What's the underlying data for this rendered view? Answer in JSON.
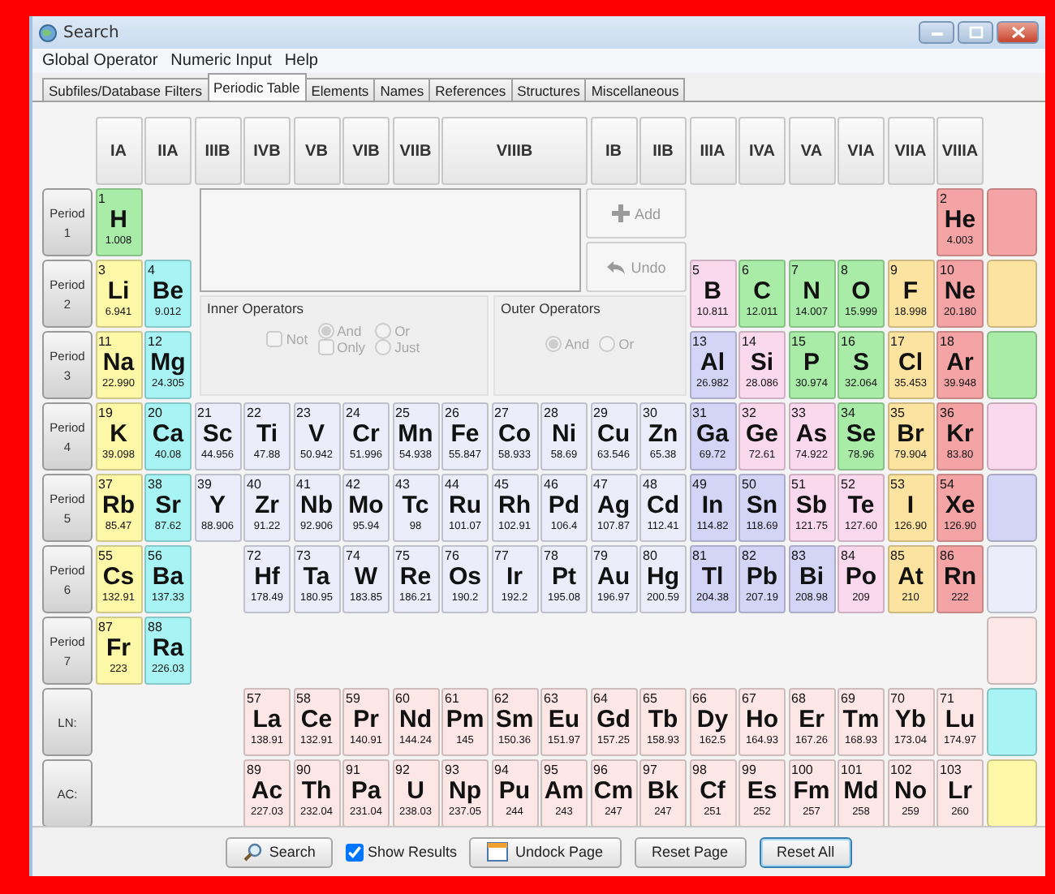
{
  "window": {
    "title": "Search"
  },
  "menu": [
    "Global Operator",
    "Numeric Input",
    "Help"
  ],
  "tabs": [
    {
      "label": "Subfiles/Database Filters",
      "selected": false
    },
    {
      "label": "Periodic Table",
      "selected": true
    },
    {
      "label": "Elements",
      "selected": false
    },
    {
      "label": "Names",
      "selected": false
    },
    {
      "label": "References",
      "selected": false
    },
    {
      "label": "Structures",
      "selected": false
    },
    {
      "label": "Miscellaneous",
      "selected": false
    }
  ],
  "groups": [
    "IA",
    "IIA",
    "IIIB",
    "IVB",
    "VB",
    "VIB",
    "VIIB",
    "VIIIB",
    "IB",
    "IIB",
    "IIIA",
    "IVA",
    "VA",
    "VIA",
    "VIIA",
    "VIIIA"
  ],
  "rows": [
    {
      "label": "Period",
      "number": "1",
      "left": [
        {
          "number": "1",
          "symbol": "H",
          "mass": "1.008",
          "color": "#a8eca8"
        }
      ],
      "right": [
        {
          "number": "2",
          "symbol": "He",
          "mass": "4.003",
          "color": "#f4a4a4"
        }
      ]
    },
    {
      "label": "Period",
      "number": "2",
      "left": [
        {
          "number": "3",
          "symbol": "Li",
          "mass": "6.941",
          "color": "#fdf7a8"
        },
        {
          "number": "4",
          "symbol": "Be",
          "mass": "9.012",
          "color": "#a8f4f4"
        }
      ],
      "right": [
        {
          "number": "5",
          "symbol": "B",
          "mass": "10.811",
          "color": "#fad8ee"
        },
        {
          "number": "6",
          "symbol": "C",
          "mass": "12.011",
          "color": "#a8eca8"
        },
        {
          "number": "7",
          "symbol": "N",
          "mass": "14.007",
          "color": "#a8eca8"
        },
        {
          "number": "8",
          "symbol": "O",
          "mass": "15.999",
          "color": "#a8eca8"
        },
        {
          "number": "9",
          "symbol": "F",
          "mass": "18.998",
          "color": "#fce4a0"
        },
        {
          "number": "10",
          "symbol": "Ne",
          "mass": "20.180",
          "color": "#f4a4a4"
        }
      ]
    },
    {
      "label": "Period",
      "number": "3",
      "left": [
        {
          "number": "11",
          "symbol": "Na",
          "mass": "22.990",
          "color": "#fdf7a8"
        },
        {
          "number": "12",
          "symbol": "Mg",
          "mass": "24.305",
          "color": "#a8f4f4"
        }
      ],
      "right": [
        {
          "number": "13",
          "symbol": "Al",
          "mass": "26.982",
          "color": "#d4d4f6"
        },
        {
          "number": "14",
          "symbol": "Si",
          "mass": "28.086",
          "color": "#fad8ee"
        },
        {
          "number": "15",
          "symbol": "P",
          "mass": "30.974",
          "color": "#a8eca8"
        },
        {
          "number": "16",
          "symbol": "S",
          "mass": "32.064",
          "color": "#a8eca8"
        },
        {
          "number": "17",
          "symbol": "Cl",
          "mass": "35.453",
          "color": "#fce4a0"
        },
        {
          "number": "18",
          "symbol": "Ar",
          "mass": "39.948",
          "color": "#f4a4a4"
        }
      ]
    },
    {
      "label": "Period",
      "number": "4",
      "left": [
        {
          "number": "19",
          "symbol": "K",
          "mass": "39.098",
          "color": "#fdf7a8"
        },
        {
          "number": "20",
          "symbol": "Ca",
          "mass": "40.08",
          "color": "#a8f4f4"
        },
        {
          "number": "21",
          "symbol": "Sc",
          "mass": "44.956",
          "color": "#ececfa"
        },
        {
          "number": "22",
          "symbol": "Ti",
          "mass": "47.88",
          "color": "#ececfa"
        },
        {
          "number": "23",
          "symbol": "V",
          "mass": "50.942",
          "color": "#ececfa"
        },
        {
          "number": "24",
          "symbol": "Cr",
          "mass": "51.996",
          "color": "#ececfa"
        },
        {
          "number": "25",
          "symbol": "Mn",
          "mass": "54.938",
          "color": "#ececfa"
        },
        {
          "number": "26",
          "symbol": "Fe",
          "mass": "55.847",
          "color": "#ececfa"
        },
        {
          "number": "27",
          "symbol": "Co",
          "mass": "58.933",
          "color": "#ececfa"
        },
        {
          "number": "28",
          "symbol": "Ni",
          "mass": "58.69",
          "color": "#ececfa"
        },
        {
          "number": "29",
          "symbol": "Cu",
          "mass": "63.546",
          "color": "#ececfa"
        },
        {
          "number": "30",
          "symbol": "Zn",
          "mass": "65.38",
          "color": "#ececfa"
        },
        {
          "number": "31",
          "symbol": "Ga",
          "mass": "69.72",
          "color": "#d4d4f6"
        },
        {
          "number": "32",
          "symbol": "Ge",
          "mass": "72.61",
          "color": "#fad8ee"
        },
        {
          "number": "33",
          "symbol": "As",
          "mass": "74.922",
          "color": "#fad8ee"
        },
        {
          "number": "34",
          "symbol": "Se",
          "mass": "78.96",
          "color": "#a8eca8"
        },
        {
          "number": "35",
          "symbol": "Br",
          "mass": "79.904",
          "color": "#fce4a0"
        },
        {
          "number": "36",
          "symbol": "Kr",
          "mass": "83.80",
          "color": "#f4a4a4"
        }
      ],
      "right": []
    },
    {
      "label": "Period",
      "number": "5",
      "left": [
        {
          "number": "37",
          "symbol": "Rb",
          "mass": "85.47",
          "color": "#fdf7a8"
        },
        {
          "number": "38",
          "symbol": "Sr",
          "mass": "87.62",
          "color": "#a8f4f4"
        },
        {
          "number": "39",
          "symbol": "Y",
          "mass": "88.906",
          "color": "#ececfa"
        },
        {
          "number": "40",
          "symbol": "Zr",
          "mass": "91.22",
          "color": "#ececfa"
        },
        {
          "number": "41",
          "symbol": "Nb",
          "mass": "92.906",
          "color": "#ececfa"
        },
        {
          "number": "42",
          "symbol": "Mo",
          "mass": "95.94",
          "color": "#ececfa"
        },
        {
          "number": "43",
          "symbol": "Tc",
          "mass": "98",
          "color": "#ececfa"
        },
        {
          "number": "44",
          "symbol": "Ru",
          "mass": "101.07",
          "color": "#ececfa"
        },
        {
          "number": "45",
          "symbol": "Rh",
          "mass": "102.91",
          "color": "#ececfa"
        },
        {
          "number": "46",
          "symbol": "Pd",
          "mass": "106.4",
          "color": "#ececfa"
        },
        {
          "number": "47",
          "symbol": "Ag",
          "mass": "107.87",
          "color": "#ececfa"
        },
        {
          "number": "48",
          "symbol": "Cd",
          "mass": "112.41",
          "color": "#ececfa"
        },
        {
          "number": "49",
          "symbol": "In",
          "mass": "114.82",
          "color": "#d4d4f6"
        },
        {
          "number": "50",
          "symbol": "Sn",
          "mass": "118.69",
          "color": "#d4d4f6"
        },
        {
          "number": "51",
          "symbol": "Sb",
          "mass": "121.75",
          "color": "#fad8ee"
        },
        {
          "number": "52",
          "symbol": "Te",
          "mass": "127.60",
          "color": "#fad8ee"
        },
        {
          "number": "53",
          "symbol": "I",
          "mass": "126.90",
          "color": "#fce4a0"
        },
        {
          "number": "54",
          "symbol": "Xe",
          "mass": "126.90",
          "color": "#f4a4a4"
        }
      ],
      "right": []
    },
    {
      "label": "Period",
      "number": "6",
      "left": [
        {
          "number": "55",
          "symbol": "Cs",
          "mass": "132.91",
          "color": "#fdf7a8"
        },
        {
          "number": "56",
          "symbol": "Ba",
          "mass": "137.33",
          "color": "#a8f4f4"
        }
      ],
      "right": [
        {
          "number": "72",
          "symbol": "Hf",
          "mass": "178.49",
          "color": "#ececfa"
        },
        {
          "number": "73",
          "symbol": "Ta",
          "mass": "180.95",
          "color": "#ececfa"
        },
        {
          "number": "74",
          "symbol": "W",
          "mass": "183.85",
          "color": "#ececfa"
        },
        {
          "number": "75",
          "symbol": "Re",
          "mass": "186.21",
          "color": "#ececfa"
        },
        {
          "number": "76",
          "symbol": "Os",
          "mass": "190.2",
          "color": "#ececfa"
        },
        {
          "number": "77",
          "symbol": "Ir",
          "mass": "192.2",
          "color": "#ececfa"
        },
        {
          "number": "78",
          "symbol": "Pt",
          "mass": "195.08",
          "color": "#ececfa"
        },
        {
          "number": "79",
          "symbol": "Au",
          "mass": "196.97",
          "color": "#ececfa"
        },
        {
          "number": "80",
          "symbol": "Hg",
          "mass": "200.59",
          "color": "#ececfa"
        },
        {
          "number": "81",
          "symbol": "Tl",
          "mass": "204.38",
          "color": "#d4d4f6"
        },
        {
          "number": "82",
          "symbol": "Pb",
          "mass": "207.19",
          "color": "#d4d4f6"
        },
        {
          "number": "83",
          "symbol": "Bi",
          "mass": "208.98",
          "color": "#d4d4f6"
        },
        {
          "number": "84",
          "symbol": "Po",
          "mass": "209",
          "color": "#fad8ee"
        },
        {
          "number": "85",
          "symbol": "At",
          "mass": "210",
          "color": "#fce4a0"
        },
        {
          "number": "86",
          "symbol": "Rn",
          "mass": "222",
          "color": "#f4a4a4"
        }
      ]
    },
    {
      "label": "Period",
      "number": "7",
      "left": [
        {
          "number": "87",
          "symbol": "Fr",
          "mass": "223",
          "color": "#fdf7a8"
        },
        {
          "number": "88",
          "symbol": "Ra",
          "mass": "226.03",
          "color": "#a8f4f4"
        }
      ],
      "right": []
    },
    {
      "label": "LN:",
      "number": "",
      "left": [],
      "right": [
        {
          "number": "57",
          "symbol": "La",
          "mass": "138.91",
          "color": "#fce6e6"
        },
        {
          "number": "58",
          "symbol": "Ce",
          "mass": "132.91",
          "color": "#fce6e6"
        },
        {
          "number": "59",
          "symbol": "Pr",
          "mass": "140.91",
          "color": "#fce6e6"
        },
        {
          "number": "60",
          "symbol": "Nd",
          "mass": "144.24",
          "color": "#fce6e6"
        },
        {
          "number": "61",
          "symbol": "Pm",
          "mass": "145",
          "color": "#fce6e6"
        },
        {
          "number": "62",
          "symbol": "Sm",
          "mass": "150.36",
          "color": "#fce6e6"
        },
        {
          "number": "63",
          "symbol": "Eu",
          "mass": "151.97",
          "color": "#fce6e6"
        },
        {
          "number": "64",
          "symbol": "Gd",
          "mass": "157.25",
          "color": "#fce6e6"
        },
        {
          "number": "65",
          "symbol": "Tb",
          "mass": "158.93",
          "color": "#fce6e6"
        },
        {
          "number": "66",
          "symbol": "Dy",
          "mass": "162.5",
          "color": "#fce6e6"
        },
        {
          "number": "67",
          "symbol": "Ho",
          "mass": "164.93",
          "color": "#fce6e6"
        },
        {
          "number": "68",
          "symbol": "Er",
          "mass": "167.26",
          "color": "#fce6e6"
        },
        {
          "number": "69",
          "symbol": "Tm",
          "mass": "168.93",
          "color": "#fce6e6"
        },
        {
          "number": "70",
          "symbol": "Yb",
          "mass": "173.04",
          "color": "#fce6e6"
        },
        {
          "number": "71",
          "symbol": "Lu",
          "mass": "174.97",
          "color": "#fce6e6"
        }
      ]
    },
    {
      "label": "AC:",
      "number": "",
      "left": [],
      "right": [
        {
          "number": "89",
          "symbol": "Ac",
          "mass": "227.03",
          "color": "#fce6e6"
        },
        {
          "number": "90",
          "symbol": "Th",
          "mass": "232.04",
          "color": "#fce6e6"
        },
        {
          "number": "91",
          "symbol": "Pa",
          "mass": "231.04",
          "color": "#fce6e6"
        },
        {
          "number": "92",
          "symbol": "U",
          "mass": "238.03",
          "color": "#fce6e6"
        },
        {
          "number": "93",
          "symbol": "Np",
          "mass": "237.05",
          "color": "#fce6e6"
        },
        {
          "number": "94",
          "symbol": "Pu",
          "mass": "244",
          "color": "#fce6e6"
        },
        {
          "number": "95",
          "symbol": "Am",
          "mass": "243",
          "color": "#fce6e6"
        },
        {
          "number": "96",
          "symbol": "Cm",
          "mass": "247",
          "color": "#fce6e6"
        },
        {
          "number": "97",
          "symbol": "Bk",
          "mass": "247",
          "color": "#fce6e6"
        },
        {
          "number": "98",
          "symbol": "Cf",
          "mass": "251",
          "color": "#fce6e6"
        },
        {
          "number": "99",
          "symbol": "Es",
          "mass": "252",
          "color": "#fce6e6"
        },
        {
          "number": "100",
          "symbol": "Fm",
          "mass": "257",
          "color": "#fce6e6"
        },
        {
          "number": "101",
          "symbol": "Md",
          "mass": "258",
          "color": "#fce6e6"
        },
        {
          "number": "102",
          "symbol": "No",
          "mass": "259",
          "color": "#fce6e6"
        },
        {
          "number": "103",
          "symbol": "Lr",
          "mass": "260",
          "color": "#fce6e6"
        }
      ]
    }
  ],
  "legend": [
    {
      "color": "#f4a4a4"
    },
    {
      "color": "#fce4a0"
    },
    {
      "color": "#a8eca8"
    },
    {
      "color": "#fad8ee"
    },
    {
      "color": "#d4d4f6"
    },
    {
      "color": "#ececfa"
    },
    {
      "color": "#fce6e6"
    },
    {
      "color": "#a8f4f4"
    },
    {
      "color": "#fdf7a8"
    }
  ],
  "actions": [
    {
      "label": "Add",
      "kind": "add",
      "disabled": true
    },
    {
      "label": "Undo",
      "kind": "undo",
      "disabled": true
    }
  ],
  "inner_operators": {
    "title": "Inner Operators",
    "disabled": true,
    "options": [
      {
        "label": "Not",
        "kind": "checkbox",
        "checked": false
      },
      {
        "label": "And",
        "kind": "radio",
        "checked": true
      },
      {
        "label": "Or",
        "kind": "radio",
        "checked": false
      },
      {
        "label": "Only",
        "kind": "checkbox",
        "checked": false
      },
      {
        "label": "Just",
        "kind": "radio",
        "checked": false
      }
    ]
  },
  "outer_operators": {
    "title": "Outer Operators",
    "disabled": true,
    "options": [
      {
        "label": "And",
        "kind": "radio",
        "checked": true
      },
      {
        "label": "Or",
        "kind": "radio",
        "checked": false
      }
    ]
  },
  "footer": [
    {
      "label": "Search",
      "kind": "search",
      "focused": false
    },
    {
      "label": "Show Results",
      "kind": "checkbox",
      "checked": true
    },
    {
      "label": "Undock Page",
      "kind": "undock",
      "focused": false
    },
    {
      "label": "Reset Page",
      "kind": "button",
      "focused": false
    },
    {
      "label": "Reset All",
      "kind": "button",
      "focused": true
    }
  ]
}
